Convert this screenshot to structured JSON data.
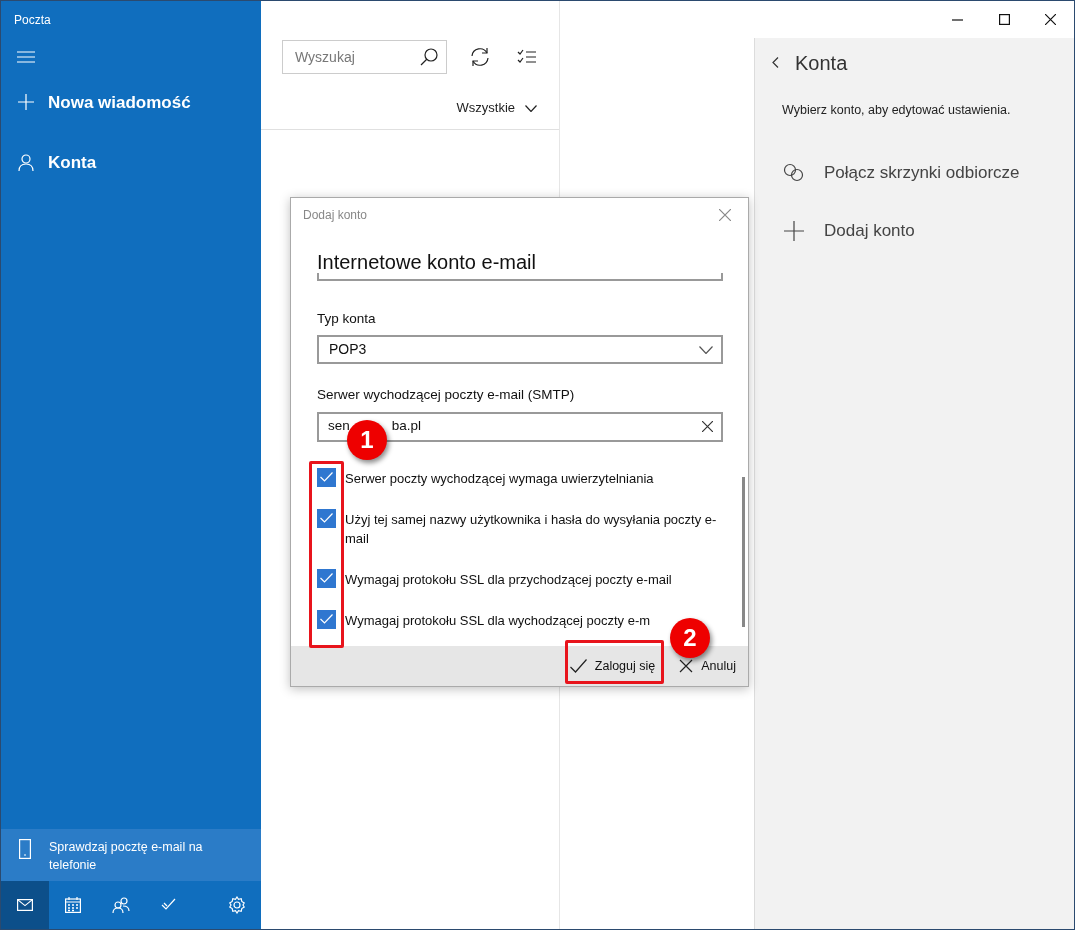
{
  "app_title": "Poczta",
  "nav": [
    {
      "kind": "new",
      "label": "Nowa wiadomość"
    },
    {
      "kind": "accounts",
      "label": "Konta"
    }
  ],
  "promo": {
    "text": "Sprawdzaj pocztę e-mail na telefonie"
  },
  "bottom_nav": [
    {
      "kind": "mail",
      "selected": true
    },
    {
      "kind": "calendar",
      "selected": false
    },
    {
      "kind": "people",
      "selected": false
    },
    {
      "kind": "todo",
      "selected": false
    },
    {
      "kind": "settings",
      "selected": false
    }
  ],
  "message_list": {
    "search_placeholder": "Wyszukaj",
    "filter": "Wszystkie"
  },
  "settings_pane": {
    "title": "Konta",
    "hint": "Wybierz konto, aby edytować ustawienia.",
    "items": [
      {
        "kind": "link",
        "label": "Połącz skrzynki odbiorcze"
      },
      {
        "kind": "add",
        "label": "Dodaj konto"
      }
    ]
  },
  "dialog": {
    "title": "Dodaj konto",
    "heading": "Internetowe konto e-mail",
    "fields": [
      {
        "kind": "select",
        "label": "Typ konta",
        "value": "POP3"
      },
      {
        "kind": "text",
        "label": "Serwer wychodzącej poczty e-mail (SMTP)",
        "value_start": "sen",
        "value_end": "ba.pl"
      }
    ],
    "options": [
      {
        "label": "Serwer poczty wychodzącej wymaga uwierzytelniania",
        "checked": true
      },
      {
        "label": "Użyj tej samej nazwy użytkownika i hasła do wysyłania poczty e-mail",
        "checked": true
      },
      {
        "label": "Wymagaj protokołu SSL dla przychodzącej poczty e-mail",
        "checked": true
      },
      {
        "label": "Wymagaj protokołu SSL dla wychodzącej poczty e-m",
        "checked": true
      }
    ],
    "buttons": [
      {
        "kind": "confirm",
        "label": "Zaloguj się"
      },
      {
        "kind": "cancel",
        "label": "Anuluj"
      }
    ]
  },
  "annotations": [
    {
      "label": "1"
    },
    {
      "label": "2"
    }
  ]
}
